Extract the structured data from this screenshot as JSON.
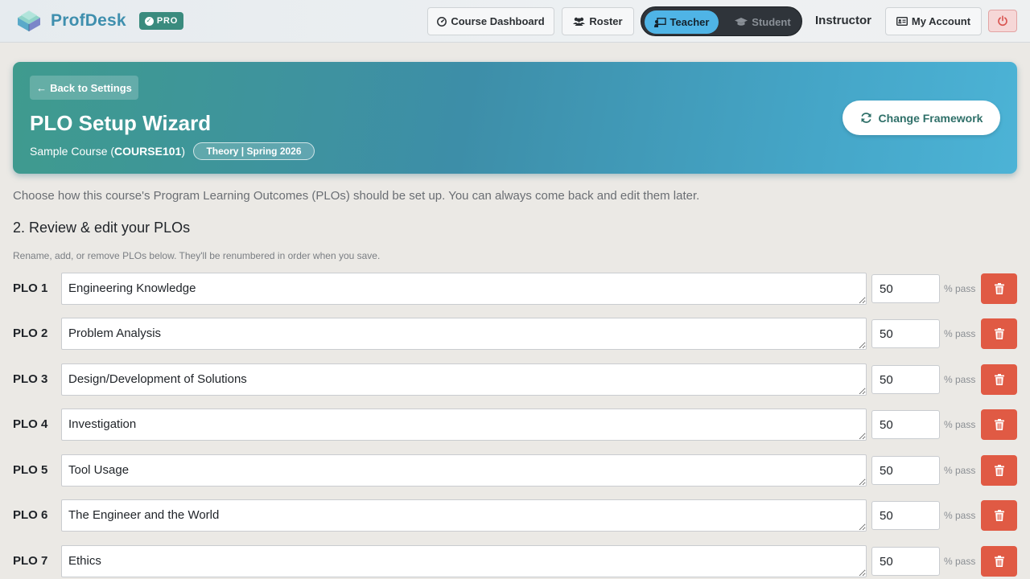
{
  "brand": {
    "name": "ProfDesk",
    "badge": "PRO",
    "logo_icon": "stacked-books-icon"
  },
  "nav": {
    "course_dashboard": "Course Dashboard",
    "roster": "Roster",
    "role_teacher": "Teacher",
    "role_student": "Student",
    "active_role": "Teacher",
    "user_role": "Instructor",
    "my_account": "My Account"
  },
  "hero": {
    "back": "Back to Settings",
    "title": "PLO Setup Wizard",
    "course_name": "Sample Course (",
    "course_code": "COURSE101",
    "course_close": ")",
    "term": "Theory | Spring 2026",
    "change_framework": "Change Framework"
  },
  "intro": "Choose how this course's Program Learning Outcomes (PLOs) should be set up. You can always come back and edit them later.",
  "section": {
    "title": "2. Review & edit your PLOs",
    "hint": "Rename, add, or remove PLOs below. They'll be renumbered in order when you save."
  },
  "pct_suffix": "% pass",
  "plos": [
    {
      "label": "PLO 1",
      "name": "Engineering Knowledge",
      "pass": "50"
    },
    {
      "label": "PLO 2",
      "name": "Problem Analysis",
      "pass": "50"
    },
    {
      "label": "PLO 3",
      "name": "Design/Development of Solutions",
      "pass": "50"
    },
    {
      "label": "PLO 4",
      "name": "Investigation",
      "pass": "50"
    },
    {
      "label": "PLO 5",
      "name": "Tool Usage",
      "pass": "50"
    },
    {
      "label": "PLO 6",
      "name": "The Engineer and the World",
      "pass": "50"
    },
    {
      "label": "PLO 7",
      "name": "Ethics",
      "pass": "50"
    }
  ],
  "colors": {
    "brand_text": "#3f8fae",
    "pro_badge": "#3a8b7e",
    "teacher_active": "#4fb4e6",
    "delete_button": "#e05a44",
    "hero_gradient_start": "#3f9b8e",
    "hero_gradient_end": "#4cb3d6"
  }
}
